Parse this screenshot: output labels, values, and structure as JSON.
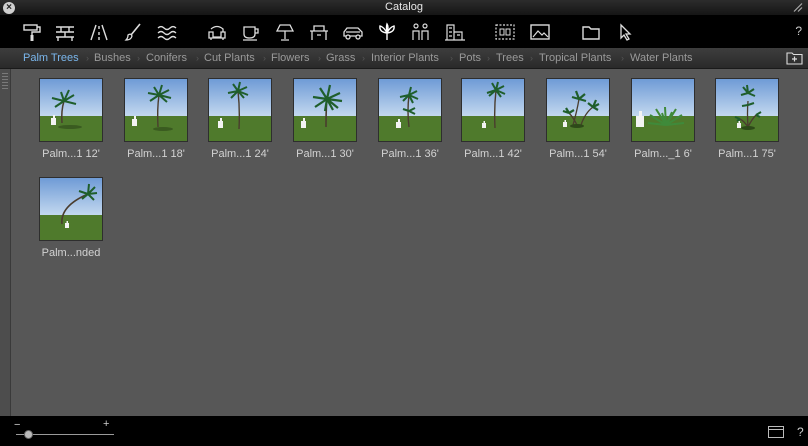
{
  "window": {
    "title": "Catalog"
  },
  "toolbar": {
    "icons": [
      "paint-roller-icon",
      "brick-wall-icon",
      "road-icon",
      "landscape-brush-icon",
      "water-icon",
      "sofa-icon",
      "cup-icon",
      "lamp-icon",
      "desk-icon",
      "car-icon",
      "plant-icon",
      "people-icon",
      "buildings-icon",
      "frame-icon",
      "image-icon",
      "folder-icon",
      "cursor-icon"
    ],
    "selected_icon": "plant-icon",
    "help_label": "?"
  },
  "categories": {
    "items": [
      "Palm Trees",
      "Bushes",
      "Conifers",
      "Cut Plants",
      "Flowers",
      "Grass",
      "Interior Plants",
      "Pots",
      "Trees",
      "Tropical Plants",
      "Water Plants"
    ],
    "active": "Palm Trees"
  },
  "items": [
    {
      "label": "Palm...1 12'"
    },
    {
      "label": "Palm...1 18'"
    },
    {
      "label": "Palm...1 24'"
    },
    {
      "label": "Palm...1 30'"
    },
    {
      "label": "Palm...1 36'"
    },
    {
      "label": "Palm...1 42'"
    },
    {
      "label": "Palm...1 54'"
    },
    {
      "label": "Palm..._1 6'"
    },
    {
      "label": "Palm...1 75'"
    },
    {
      "label": "Palm...nded"
    }
  ],
  "footer": {
    "zoom_minus": "−",
    "zoom_plus": "+",
    "help_label": "?"
  },
  "colors": {
    "accent": "#7ab6ec",
    "background": "#575757",
    "sky": "#8fb3e0",
    "grass": "#4f7a2c"
  }
}
